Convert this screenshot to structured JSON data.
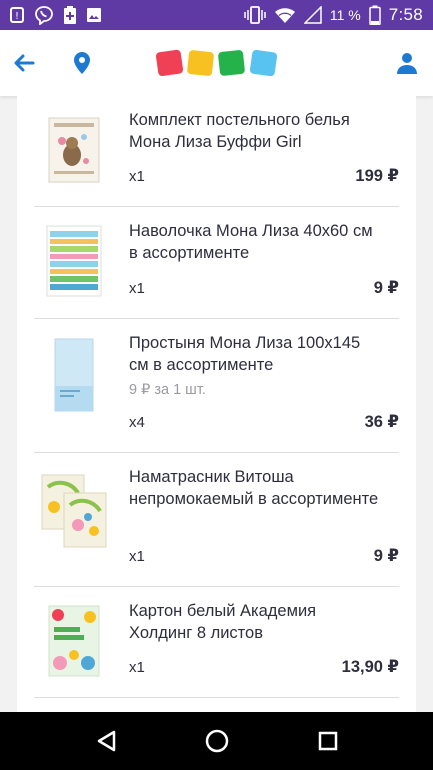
{
  "status_bar": {
    "battery_percent": "11 %",
    "time": "7:58",
    "icons": [
      "notification-icon",
      "viber-icon",
      "battery-saver-icon",
      "gallery-icon",
      "vibrate-icon",
      "wifi-icon",
      "signal-icon",
      "battery-icon"
    ]
  },
  "topbar": {
    "logo_colors": [
      "#ef4056",
      "#f7c221",
      "#25b24a",
      "#58c3f0"
    ],
    "accent": "#1e7ad1"
  },
  "items": [
    {
      "title": "Комплект постельного белья Мона Лиза Буффи Girl",
      "unit_price": "",
      "quantity": "х1",
      "price": "199 ₽",
      "thumb_icon": "bedding-set-thumbnail"
    },
    {
      "title": "Наволочка Мона Лиза 40х60 см в ассортименте",
      "unit_price": "",
      "quantity": "х1",
      "price": "9 ₽",
      "thumb_icon": "pillowcase-thumbnail"
    },
    {
      "title": "Простыня Мона Лиза 100х145 см в ассортименте",
      "unit_price": "9 ₽ за 1 шт.",
      "quantity": "х4",
      "price": "36 ₽",
      "thumb_icon": "bedsheet-thumbnail"
    },
    {
      "title": "Наматрасник Витоша непромокаемый в ассортименте",
      "unit_price": "",
      "quantity": "х1",
      "price": "9 ₽",
      "thumb_icon": "mattress-pad-thumbnail"
    },
    {
      "title": "Картон белый Академия Холдинг 8 листов",
      "unit_price": "",
      "quantity": "х1",
      "price": "13,90 ₽",
      "thumb_icon": "cardboard-thumbnail"
    }
  ]
}
